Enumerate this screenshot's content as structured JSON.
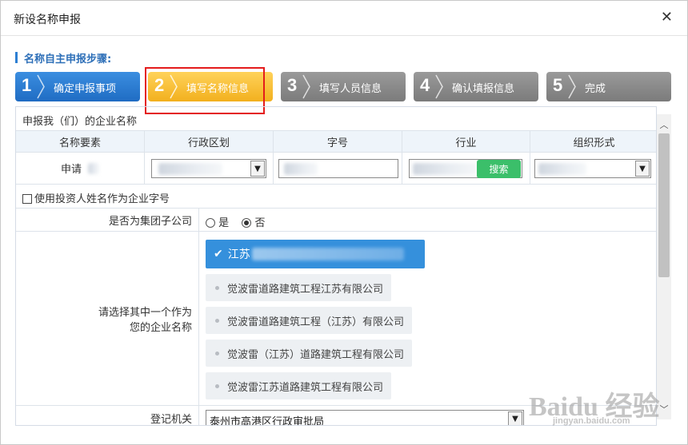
{
  "dialog": {
    "title": "新设名称申报",
    "close_icon": "close-icon"
  },
  "steps_heading": "名称自主申报步骤:",
  "steps": [
    {
      "num": "1",
      "label": "确定申报事项",
      "state": "done"
    },
    {
      "num": "2",
      "label": "填写名称信息",
      "state": "active"
    },
    {
      "num": "3",
      "label": "填写人员信息",
      "state": "pending"
    },
    {
      "num": "4",
      "label": "确认填报信息",
      "state": "pending"
    },
    {
      "num": "5",
      "label": "完成",
      "state": "pending"
    }
  ],
  "colors": {
    "step_done": "#1f6cc3",
    "step_active": "#f2b01e",
    "step_pending": "#7b7b7b",
    "highlight": "#e41b1b",
    "selected": "#3590dc",
    "search_btn": "#3bbf6a"
  },
  "form": {
    "section_title": "申报我（们）的企业名称",
    "headers": [
      "名称要素",
      "行政区划",
      "字号",
      "行业",
      "组织形式"
    ],
    "apply_label": "申请",
    "search_button": "搜索",
    "use_investor_name": "使用投资人姓名作为企业字号",
    "group_label": "是否为集团子公司",
    "group_yes": "是",
    "group_no": "否",
    "group_selected": "否",
    "choose_label_line1": "请选择其中一个作为",
    "choose_label_line2": "您的企业名称",
    "selected_name_prefix": "江苏",
    "name_options": [
      "觉波雷道路建筑工程江苏有限公司",
      "觉波雷道路建筑工程（江苏）有限公司",
      "觉波雷（江苏）道路建筑工程有限公司",
      "觉波雷江苏道路建筑工程有限公司"
    ],
    "registry_label": "登记机关",
    "registry_value": "泰州市高港区行政审批局"
  },
  "watermark": {
    "brand": "Baidu 经验",
    "url": "jingyan.baidu.com"
  }
}
